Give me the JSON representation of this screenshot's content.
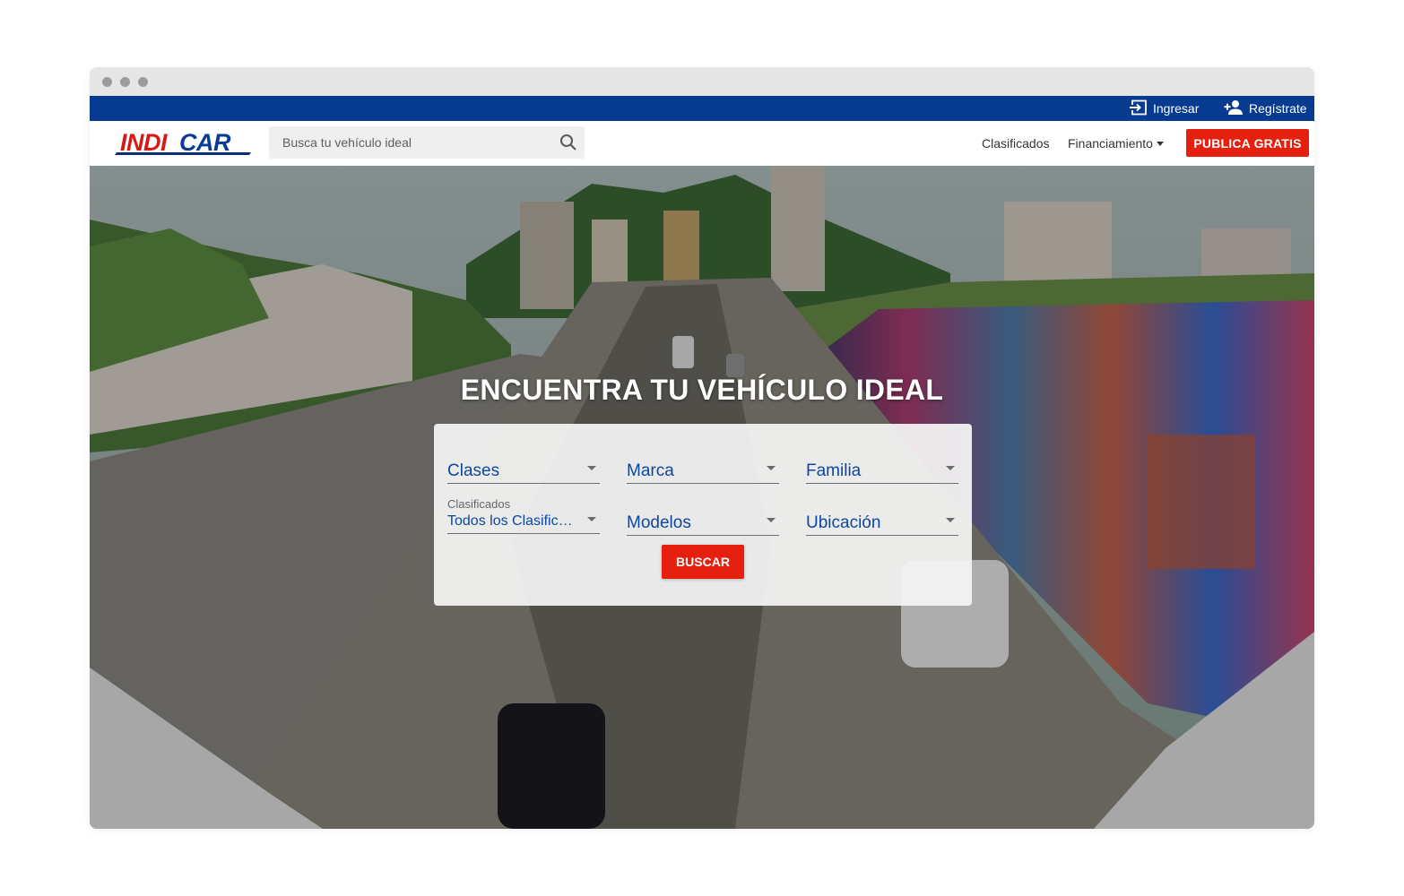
{
  "topbar": {
    "login_label": "Ingresar",
    "register_label": "Regístrate",
    "background": "#073a91"
  },
  "navbar": {
    "logo_text": "INDICAR",
    "search_placeholder": "Busca tu vehículo ideal",
    "links": {
      "classifieds": "Clasificados",
      "financing": "Financiamiento"
    },
    "publish_label": "PUBLICA GRATIS"
  },
  "hero": {
    "title": "ENCUENTRA TU VEHÍCULO IDEAL",
    "search": {
      "classes": "Clases",
      "brand": "Marca",
      "family": "Familia",
      "classified_label": "Clasificados",
      "classified_value": "Todos los Clasificados",
      "models": "Modelos",
      "location": "Ubicación",
      "search_label": "BUSCAR"
    }
  },
  "colors": {
    "accent_red": "#e6200e",
    "brand_blue": "#073a91",
    "field_text": "#0b48a0"
  },
  "icons": [
    "login-icon",
    "add-user-icon",
    "search-icon",
    "chevron-down-icon"
  ]
}
